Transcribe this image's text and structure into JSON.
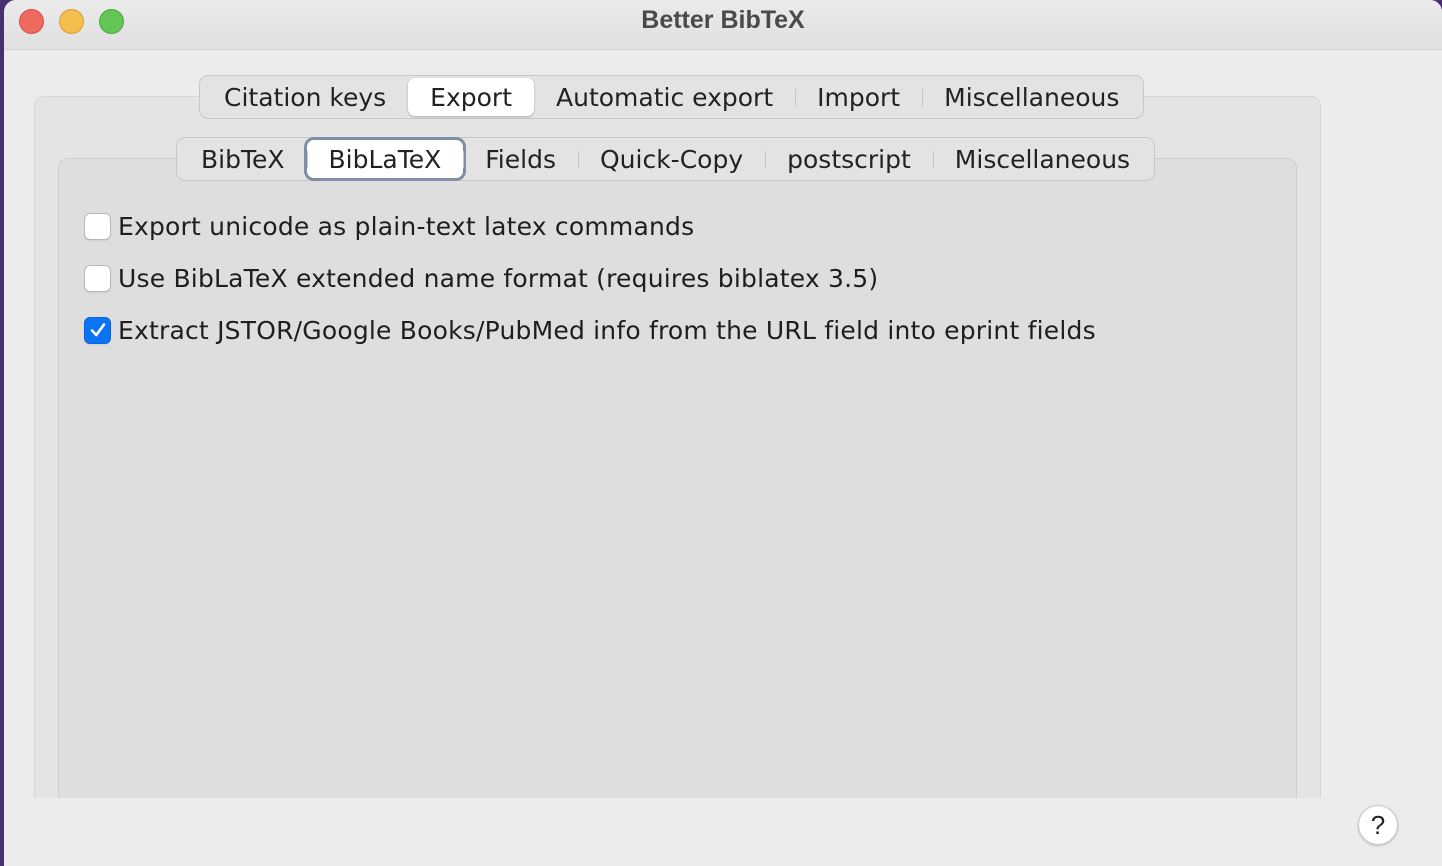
{
  "window": {
    "title": "Better BibTeX"
  },
  "top_tabs": [
    {
      "label": "Citation keys",
      "active": false
    },
    {
      "label": "Export",
      "active": true
    },
    {
      "label": "Automatic export",
      "active": false
    },
    {
      "label": "Import",
      "active": false
    },
    {
      "label": "Miscellaneous",
      "active": false
    }
  ],
  "sub_tabs": [
    {
      "label": "BibTeX",
      "active": false
    },
    {
      "label": "BibLaTeX",
      "active": true
    },
    {
      "label": "Fields",
      "active": false
    },
    {
      "label": "Quick-Copy",
      "active": false
    },
    {
      "label": "postscript",
      "active": false
    },
    {
      "label": "Miscellaneous",
      "active": false
    }
  ],
  "options": [
    {
      "label": "Export unicode as plain-text latex commands",
      "checked": false
    },
    {
      "label": "Use BibLaTeX extended name format (requires biblatex 3.5)",
      "checked": false
    },
    {
      "label": "Extract JSTOR/Google Books/PubMed info from the URL field into eprint fields",
      "checked": true
    }
  ],
  "help": {
    "label": "?"
  },
  "colors": {
    "accent": "#0a74f5",
    "close": "#ee6a5f",
    "minimize": "#f5be4f",
    "maximize": "#62c554"
  }
}
